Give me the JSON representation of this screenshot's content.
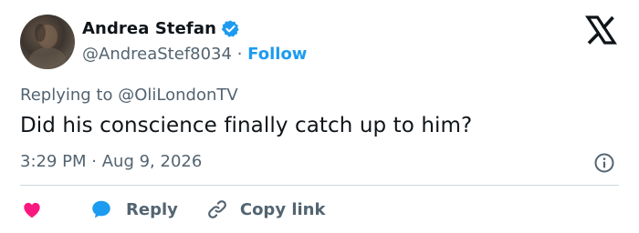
{
  "author": {
    "name": "Andrea Stefan",
    "handle": "@AndreaStef8034",
    "separator": "·",
    "follow_label": "Follow",
    "verified": true
  },
  "reply_context": {
    "prefix": "Replying to",
    "mention": "@OliLondonTV"
  },
  "tweet": {
    "text": "Did his conscience finally catch up to him?",
    "time": "3:29 PM",
    "separator": "·",
    "date": "Aug 9, 2026"
  },
  "actions": {
    "reply_label": "Reply",
    "copy_label": "Copy link"
  },
  "colors": {
    "accent": "#1d9bf0",
    "like": "#f91880",
    "text": "#0f1419",
    "secondary": "#536471",
    "divider": "#cfd9de"
  },
  "icons": {
    "verified": "verified-badge-icon",
    "brand": "x-logo-icon",
    "info": "info-icon",
    "like": "heart-icon",
    "reply": "speech-bubble-icon",
    "copy": "link-icon"
  }
}
